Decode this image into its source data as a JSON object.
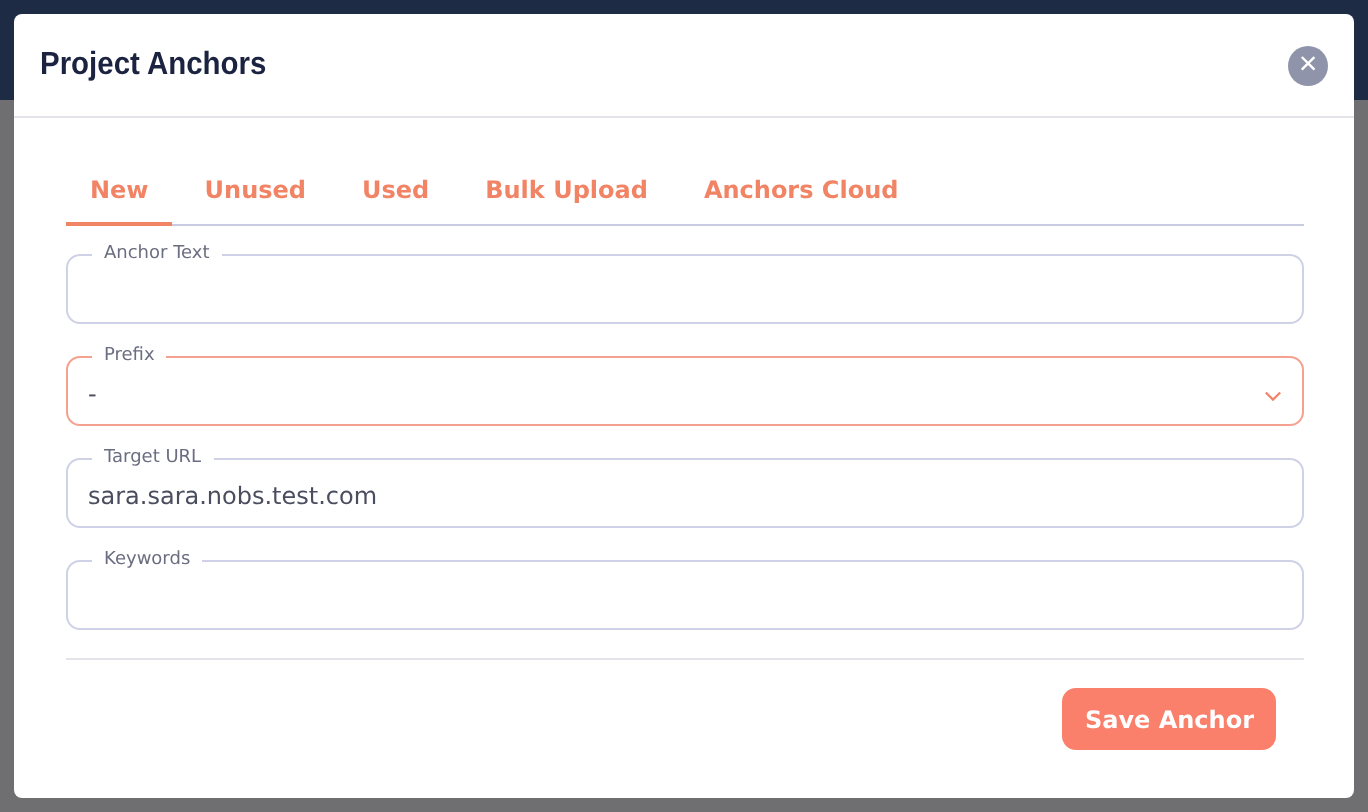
{
  "dialog": {
    "title": "Project Anchors",
    "close_icon": "×"
  },
  "tabs": [
    {
      "label": "New",
      "selected": true
    },
    {
      "label": "Unused",
      "selected": false
    },
    {
      "label": "Used",
      "selected": false
    },
    {
      "label": "Bulk Upload",
      "selected": false
    },
    {
      "label": "Anchors Cloud",
      "selected": false
    }
  ],
  "fields": [
    {
      "kind": "text",
      "label": "Anchor Text",
      "focused": false
    },
    {
      "kind": "select",
      "label": "Prefix",
      "value": "-",
      "focused": true
    },
    {
      "kind": "text",
      "label": "Target URL",
      "value": "sara.sara.nobs.test.com",
      "focused": false
    },
    {
      "kind": "text",
      "label": "Keywords",
      "focused": false
    }
  ],
  "buttons": [
    "Save Anchor"
  ]
}
